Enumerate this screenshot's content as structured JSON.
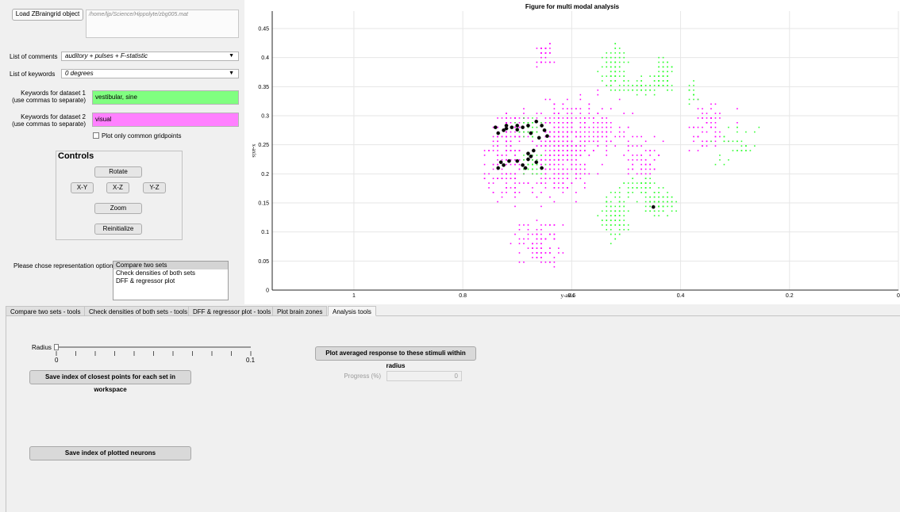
{
  "load": {
    "button_label": "Load ZBraingrid object",
    "path_text": "/home/ljp/Science/Hippolyte/zbg005.mat"
  },
  "comments": {
    "label": "List of comments",
    "value": "auditory + pulses + F-statistic"
  },
  "keywords": {
    "label": "List of keywords",
    "value": "0 degrees"
  },
  "dataset1": {
    "label_line1": "Keywords for dataset 1",
    "label_line2": "(use commas to separate)",
    "value": "vestibular, sine",
    "color": "#80ff80"
  },
  "dataset2": {
    "label_line1": "Keywords for dataset 2",
    "label_line2": "(use commas to separate)",
    "value": "visual",
    "color": "#ff80ff"
  },
  "common_gridpoints": {
    "label": "Plot only common gridpoints",
    "checked": false
  },
  "controls": {
    "title": "Controls",
    "rotate": "Rotate",
    "xy": "X-Y",
    "xz": "X-Z",
    "yz": "Y-Z",
    "zoom": "Zoom",
    "reinitialize": "Reinitialize"
  },
  "representation": {
    "label": "Please chose representation option:",
    "options": [
      "Compare two sets",
      "Check densities of both sets",
      "DFF & regressor plot"
    ],
    "selected_index": 0
  },
  "tabs": [
    "Compare two sets - tools",
    "Check densities of both sets - tools",
    "DFF & regressor plot - tools",
    "Plot brain zones",
    "Analysis tools"
  ],
  "active_tab": 4,
  "analysis": {
    "radius_label": "Radius",
    "slider_min": "0",
    "slider_max": "0.1",
    "slider_value": 0,
    "save_closest_label": "Save index of closest points for each set in workspace",
    "save_plotted_label": "Save index of plotted neurons",
    "plot_avg_label": "Plot averaged response to these stimuli within radius",
    "progress_label": "Progress (%)",
    "progress_value": "0"
  },
  "chart_data": {
    "type": "scatter",
    "title": "Figure for multi modal analysis",
    "xlabel": "y-axis",
    "ylabel": "x-axis",
    "x_reversed": true,
    "xlim": [
      0,
      1.15
    ],
    "ylim": [
      0,
      0.48
    ],
    "x_ticks": [
      "1",
      "0.8",
      "0.6",
      "0.4",
      "0.2",
      "0"
    ],
    "x_tick_values": [
      1,
      0.8,
      0.6,
      0.4,
      0.2,
      0
    ],
    "y_ticks": [
      "0",
      "0.05",
      "0.1",
      "0.15",
      "0.2",
      "0.25",
      "0.3",
      "0.35",
      "0.4",
      "0.45"
    ],
    "y_tick_values": [
      0,
      0.05,
      0.1,
      0.15,
      0.2,
      0.25,
      0.3,
      0.35,
      0.4,
      0.45
    ],
    "grid": true,
    "colors": {
      "dataset2": "#ff00ff",
      "dataset1": "#33ff33",
      "common": "#000000"
    },
    "series": [
      {
        "color": "#ff00ff",
        "clusters": [
          {
            "cx": 0.62,
            "cy": 0.24,
            "rx": 0.05,
            "ry": 0.07,
            "n": 380
          },
          {
            "cx": 0.72,
            "cy": 0.22,
            "rx": 0.035,
            "ry": 0.06,
            "n": 140
          },
          {
            "cx": 0.71,
            "cy": 0.28,
            "rx": 0.03,
            "ry": 0.03,
            "n": 60
          },
          {
            "cx": 0.66,
            "cy": 0.08,
            "rx": 0.04,
            "ry": 0.04,
            "n": 90
          },
          {
            "cx": 0.65,
            "cy": 0.41,
            "rx": 0.015,
            "ry": 0.02,
            "n": 40
          },
          {
            "cx": 0.55,
            "cy": 0.27,
            "rx": 0.06,
            "ry": 0.05,
            "n": 110
          },
          {
            "cx": 0.47,
            "cy": 0.23,
            "rx": 0.03,
            "ry": 0.03,
            "n": 50
          },
          {
            "cx": 0.35,
            "cy": 0.28,
            "rx": 0.04,
            "ry": 0.04,
            "n": 60
          }
        ]
      },
      {
        "color": "#33ff33",
        "clusters": [
          {
            "cx": 0.52,
            "cy": 0.38,
            "rx": 0.02,
            "ry": 0.04,
            "n": 90
          },
          {
            "cx": 0.48,
            "cy": 0.35,
            "rx": 0.03,
            "ry": 0.01,
            "n": 50
          },
          {
            "cx": 0.43,
            "cy": 0.37,
            "rx": 0.02,
            "ry": 0.03,
            "n": 70
          },
          {
            "cx": 0.52,
            "cy": 0.13,
            "rx": 0.025,
            "ry": 0.04,
            "n": 110
          },
          {
            "cx": 0.47,
            "cy": 0.18,
            "rx": 0.03,
            "ry": 0.015,
            "n": 50
          },
          {
            "cx": 0.44,
            "cy": 0.15,
            "rx": 0.03,
            "ry": 0.02,
            "n": 80
          },
          {
            "cx": 0.68,
            "cy": 0.28,
            "rx": 0.02,
            "ry": 0.015,
            "n": 40
          },
          {
            "cx": 0.67,
            "cy": 0.22,
            "rx": 0.02,
            "ry": 0.02,
            "n": 45
          },
          {
            "cx": 0.3,
            "cy": 0.25,
            "rx": 0.04,
            "ry": 0.04,
            "n": 35
          },
          {
            "cx": 0.38,
            "cy": 0.34,
            "rx": 0.01,
            "ry": 0.02,
            "n": 15
          }
        ]
      },
      {
        "color": "#000000",
        "points": [
          [
            0.74,
            0.28
          ],
          [
            0.735,
            0.27
          ],
          [
            0.725,
            0.275
          ],
          [
            0.72,
            0.283
          ],
          [
            0.71,
            0.28
          ],
          [
            0.7,
            0.276
          ],
          [
            0.69,
            0.28
          ],
          [
            0.68,
            0.283
          ],
          [
            0.675,
            0.27
          ],
          [
            0.665,
            0.29
          ],
          [
            0.655,
            0.283
          ],
          [
            0.65,
            0.275
          ],
          [
            0.66,
            0.262
          ],
          [
            0.645,
            0.265
          ],
          [
            0.73,
            0.22
          ],
          [
            0.725,
            0.215
          ],
          [
            0.735,
            0.21
          ],
          [
            0.715,
            0.222
          ],
          [
            0.7,
            0.222
          ],
          [
            0.69,
            0.215
          ],
          [
            0.68,
            0.225
          ],
          [
            0.675,
            0.23
          ],
          [
            0.67,
            0.24
          ],
          [
            0.68,
            0.235
          ],
          [
            0.665,
            0.22
          ],
          [
            0.685,
            0.21
          ],
          [
            0.655,
            0.21
          ],
          [
            0.72,
            0.278
          ],
          [
            0.7,
            0.283
          ],
          [
            0.45,
            0.143
          ]
        ]
      }
    ]
  }
}
